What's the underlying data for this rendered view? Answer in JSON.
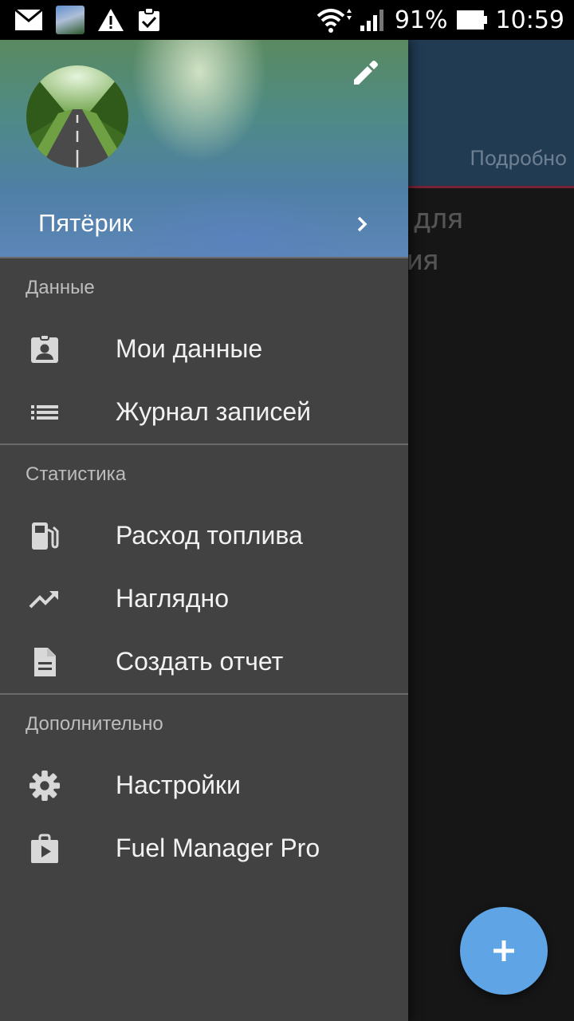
{
  "status_bar": {
    "battery_percent": "91%",
    "time": "10:59",
    "icons": [
      "mail-icon",
      "gallery-thumbnail",
      "warning-icon",
      "clipboard-check-icon",
      "wifi-icon",
      "signal-icon",
      "battery-icon"
    ]
  },
  "background_app": {
    "tab_label": "Подробно",
    "empty_text_line1": "ей для",
    "empty_text_line2": "ения",
    "fab_icon": "plus-icon",
    "colors": {
      "header": "#213b52",
      "accent_line": "#7a2235",
      "fab": "#5fa4e4"
    }
  },
  "drawer": {
    "user_name": "Пятёрик",
    "sections": [
      {
        "title": "Данные",
        "items": [
          {
            "label": "Мои данные",
            "icon": "contact-badge-icon"
          },
          {
            "label": "Журнал записей",
            "icon": "list-icon"
          }
        ]
      },
      {
        "title": "Статистика",
        "items": [
          {
            "label": "Расход топлива",
            "icon": "gas-station-icon"
          },
          {
            "label": "Наглядно",
            "icon": "trending-up-icon"
          },
          {
            "label": "Создать отчет",
            "icon": "document-icon"
          }
        ]
      },
      {
        "title": "Дополнительно",
        "items": [
          {
            "label": "Настройки",
            "icon": "gear-icon"
          },
          {
            "label": "Fuel Manager Pro",
            "icon": "play-store-icon"
          }
        ]
      }
    ],
    "colors": {
      "background": "#424242",
      "section_title": "#bdbdbd",
      "item_text": "#f2f2f2",
      "icon": "#d8d8d8"
    }
  }
}
